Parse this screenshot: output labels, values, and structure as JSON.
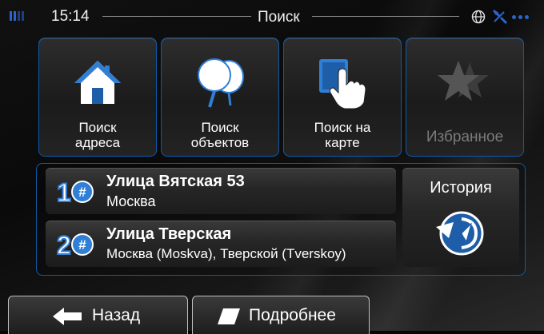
{
  "statusbar": {
    "time": "15:14",
    "title": "Поиск",
    "icons": [
      "signal-icon",
      "globe-icon",
      "satellite-icon"
    ]
  },
  "tiles": [
    {
      "label": "Поиск\nадреса",
      "icon": "house-icon",
      "enabled": true
    },
    {
      "label": "Поиск\nобъектов",
      "icon": "poi-balloons-icon",
      "enabled": true
    },
    {
      "label": "Поиск на\nкарте",
      "icon": "map-touch-icon",
      "enabled": true
    },
    {
      "label": "Избранное",
      "icon": "star-icon",
      "enabled": false
    }
  ],
  "history": {
    "label": "История",
    "items": [
      {
        "number": "1",
        "title": "Улица Вятская 53",
        "subtitle": "Москва"
      },
      {
        "number": "2",
        "title": "Улица Тверская",
        "subtitle": "Москва (Moskva), Тверской (Tverskoy)"
      }
    ]
  },
  "bottom": {
    "back_label": "Назад",
    "more_label": "Подробнее"
  },
  "colors": {
    "accent": "#0e5aa8",
    "signal": "#2e63c9",
    "disabled_text": "#7b7b7b"
  }
}
